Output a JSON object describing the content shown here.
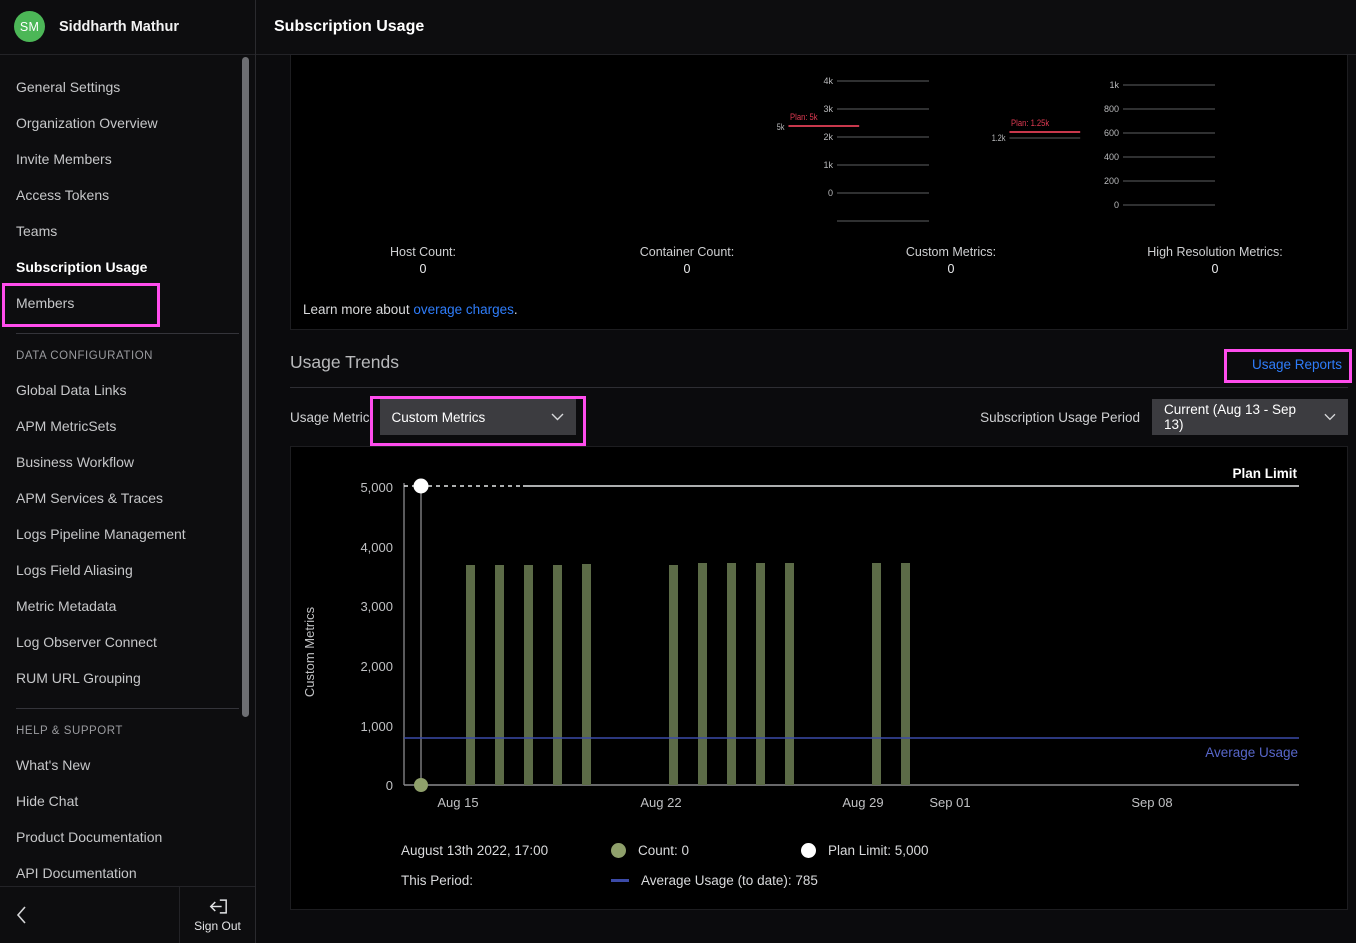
{
  "sidebar": {
    "user": {
      "initials": "SM",
      "name": "Siddharth Mathur"
    },
    "items": [
      {
        "label": "General Settings",
        "active": false
      },
      {
        "label": "Organization Overview",
        "active": false
      },
      {
        "label": "Invite Members",
        "active": false
      },
      {
        "label": "Access Tokens",
        "active": false
      },
      {
        "label": "Teams",
        "active": false
      },
      {
        "label": "Subscription Usage",
        "active": true
      },
      {
        "label": "Members",
        "active": false
      }
    ],
    "section_data_config": "DATA CONFIGURATION",
    "data_items": [
      {
        "label": "Global Data Links"
      },
      {
        "label": "APM MetricSets"
      },
      {
        "label": "Business Workflow"
      },
      {
        "label": "APM Services & Traces"
      },
      {
        "label": "Logs Pipeline Management"
      },
      {
        "label": "Logs Field Aliasing"
      },
      {
        "label": "Metric Metadata"
      },
      {
        "label": "Log Observer Connect"
      },
      {
        "label": "RUM URL Grouping"
      }
    ],
    "section_help": "HELP & SUPPORT",
    "help_items": [
      {
        "label": "What's New"
      },
      {
        "label": "Hide Chat"
      },
      {
        "label": "Product Documentation"
      },
      {
        "label": "API Documentation"
      }
    ],
    "collapse_icon": "chevron-left-icon",
    "signout_label": "Sign Out"
  },
  "topbar": {
    "title": "Subscription Usage"
  },
  "usage_panel": {
    "cells": [
      {
        "caption": "Host Count:",
        "value": "0",
        "has_chart": false
      },
      {
        "caption": "Container Count:",
        "value": "0",
        "has_chart": false
      },
      {
        "caption": "Custom Metrics:",
        "value": "0",
        "has_chart": true
      },
      {
        "caption": "High Resolution Metrics:",
        "value": "0",
        "has_chart": true
      }
    ],
    "learn_more_prefix": "Learn more about ",
    "learn_more_link": "overage charges",
    "learn_more_suffix": "."
  },
  "trends": {
    "title": "Usage Trends",
    "usage_reports_label": "Usage Reports",
    "metric_label": "Usage Metric",
    "metric_value": "Custom Metrics",
    "period_label": "Subscription Usage Period",
    "period_value": "Current (Aug 13 - Sep 13)",
    "chevron": "⌄"
  },
  "chart_footer": {
    "timestamp": "August 13th 2022, 17:00",
    "count_label": "Count: 0",
    "plan_limit_label": "Plan Limit: 5,000",
    "this_period_label": "This Period:",
    "average_label": "Average Usage (to date): 785"
  },
  "colors": {
    "highlight": "#ff4ded",
    "link": "#2f7dfa",
    "bar": "#5c6b47",
    "average_line": "#3b4aa8",
    "plan_line_red": "#c8384c",
    "avatar": "#4cb757",
    "plan_limit_dot": "#ffffff"
  },
  "chart_data": {
    "type": "bar",
    "title": "Usage Trends",
    "xlabel": "",
    "ylabel": "Custom Metrics",
    "ylim": [
      0,
      5000
    ],
    "yticks": [
      0,
      1000,
      2000,
      3000,
      4000,
      5000
    ],
    "yticklabels": [
      "0",
      "1,000",
      "2,000",
      "3,000",
      "4,000",
      "5,000"
    ],
    "xticklabels": [
      "Aug 15",
      "Aug 22",
      "Aug 29",
      "Sep 01",
      "Sep 08"
    ],
    "xtick_positions_days": [
      2,
      9,
      16,
      19,
      26
    ],
    "x_start": "Aug 13",
    "x_end": "Sep 13",
    "grid": false,
    "legend_position": "below",
    "series": [
      {
        "name": "Count",
        "type": "bar",
        "color": "#5c6b47",
        "x_days": [
          2,
          3,
          4,
          5,
          6,
          9,
          10,
          11,
          12,
          13,
          16,
          17
        ],
        "values": [
          3660,
          3660,
          3660,
          3660,
          3665,
          3660,
          3700,
          3700,
          3700,
          3700,
          3700,
          3700
        ]
      },
      {
        "name": "Plan Limit",
        "type": "line",
        "color": "#ffffff",
        "value": 5000,
        "label": "Plan Limit"
      },
      {
        "name": "Average Usage",
        "type": "line",
        "color": "#3b4aa8",
        "value": 785,
        "label": "Average Usage"
      }
    ],
    "marker_points": [
      {
        "name": "plan-limit-marker",
        "x_days": 0.55,
        "value": 5000,
        "color": "#ffffff"
      },
      {
        "name": "count-marker",
        "x_days": 0.55,
        "value": 0,
        "color": "#8fa06b"
      }
    ]
  },
  "mini_charts": [
    {
      "name": "custom-metrics-mini",
      "plan_label": "Plan: 5k",
      "yticklabels": [
        "5k",
        "4k",
        "3k",
        "2k",
        "1k",
        "0"
      ],
      "values": [
        5000,
        4000,
        3000,
        2000,
        1000,
        0
      ],
      "plan_value": 5000
    },
    {
      "name": "high-res-metrics-mini",
      "plan_label": "Plan: 1.25k",
      "yticklabels": [
        "1.2k",
        "1k",
        "800",
        "600",
        "400",
        "200",
        "0"
      ],
      "values": [
        1200,
        1000,
        800,
        600,
        400,
        200,
        0
      ],
      "plan_value": 1250
    }
  ]
}
